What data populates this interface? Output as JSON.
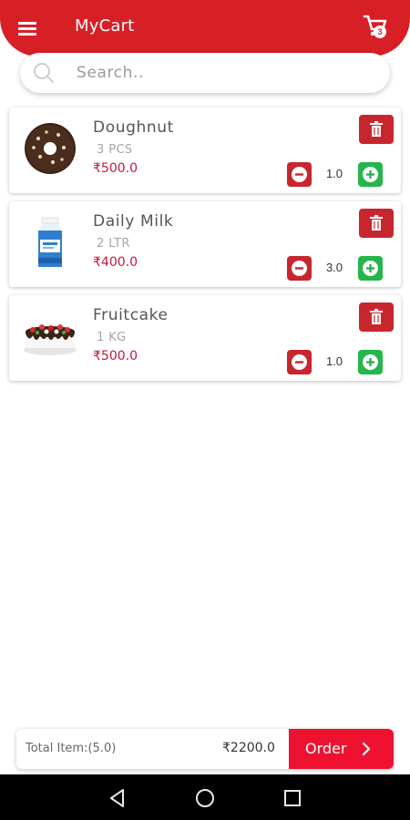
{
  "header": {
    "title": "MyCart",
    "menu_icon": "menu-icon",
    "cart_icon": "cart-icon",
    "cart_badge": "3"
  },
  "search": {
    "placeholder": "Search..",
    "value": "",
    "icon": "search-icon"
  },
  "cart": {
    "items": [
      {
        "name": "Doughnut",
        "unit": "3 PCS",
        "price": "₹500.0",
        "qty": "1.0",
        "image": "doughnut"
      },
      {
        "name": "Daily Milk",
        "unit": "2 LTR",
        "price": "₹400.0",
        "qty": "3.0",
        "image": "milk-carton"
      },
      {
        "name": "Fruitcake",
        "unit": "1 KG",
        "price": "₹500.0",
        "qty": "1.0",
        "image": "fruitcake"
      }
    ]
  },
  "footer": {
    "total_items": "Total Item:(5.0)",
    "total_amount": "₹2200.0",
    "order_label": "Order"
  },
  "nav": {
    "back": "back-icon",
    "home": "home-icon",
    "recent": "recent-apps-icon"
  },
  "colors": {
    "primary": "#d71f26",
    "delete": "#c8262e",
    "minus": "#c8262e",
    "plus": "#26b54a",
    "price": "#c2163e",
    "order_button": "#ee1230"
  }
}
